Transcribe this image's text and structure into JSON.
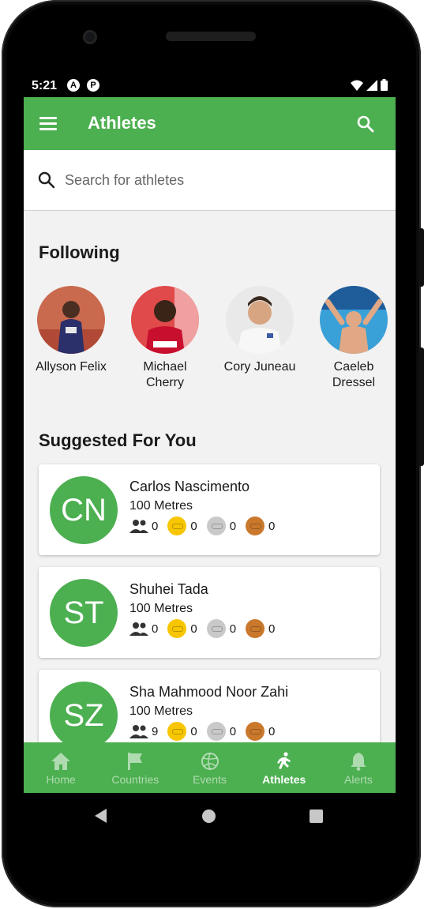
{
  "status": {
    "time": "5:21"
  },
  "appbar": {
    "title": "Athletes"
  },
  "search": {
    "placeholder": "Search for athletes"
  },
  "following": {
    "title": "Following",
    "athletes": [
      {
        "name": "Allyson Felix"
      },
      {
        "name": "Michael Cherry"
      },
      {
        "name": "Cory Juneau"
      },
      {
        "name": "Caeleb Dressel"
      }
    ]
  },
  "suggested": {
    "title": "Suggested For You",
    "athletes": [
      {
        "initials": "CN",
        "name": "Carlos Nascimento",
        "event": "100 Metres",
        "followers": "0",
        "gold": "0",
        "silver": "0",
        "bronze": "0"
      },
      {
        "initials": "ST",
        "name": "Shuhei Tada",
        "event": "100 Metres",
        "followers": "0",
        "gold": "0",
        "silver": "0",
        "bronze": "0"
      },
      {
        "initials": "SZ",
        "name": "Sha Mahmood Noor Zahi",
        "event": "100 Metres",
        "followers": "9",
        "gold": "0",
        "silver": "0",
        "bronze": "0"
      }
    ]
  },
  "nav": {
    "items": [
      {
        "label": "Home",
        "icon": "home-icon"
      },
      {
        "label": "Countries",
        "icon": "flag-icon"
      },
      {
        "label": "Events",
        "icon": "volleyball-icon"
      },
      {
        "label": "Athletes",
        "icon": "runner-icon",
        "active": true
      },
      {
        "label": "Alerts",
        "icon": "bell-icon"
      }
    ]
  },
  "colors": {
    "primary": "#4caf50",
    "gold": "#f7c600",
    "silver": "#c9c9c9",
    "bronze": "#c9782c"
  }
}
